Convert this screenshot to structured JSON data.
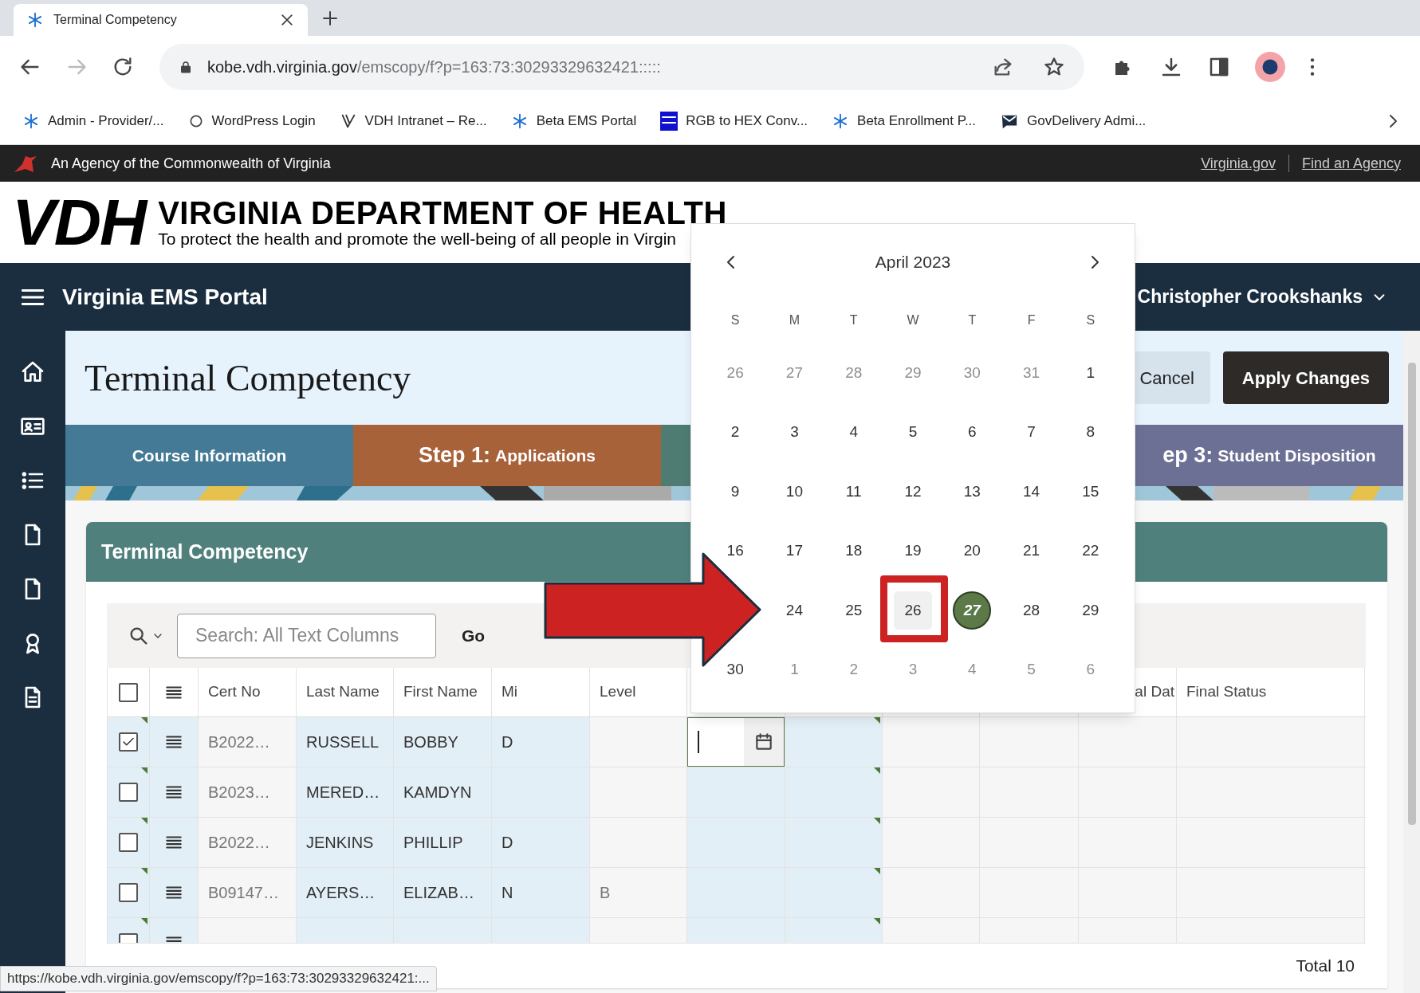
{
  "browser": {
    "tab_title": "Terminal Competency",
    "url_host": "kobe.vdh.virginia.gov",
    "url_path": "/emscopy/f?p=163:73:30293329632421:::::",
    "bookmarks": [
      {
        "label": "Admin - Provider/...",
        "kind": "asterisk"
      },
      {
        "label": "WordPress Login",
        "kind": "circle"
      },
      {
        "label": "VDH Intranet – Re...",
        "kind": "v"
      },
      {
        "label": "Beta EMS Portal",
        "kind": "asterisk"
      },
      {
        "label": "RGB to HEX Conv...",
        "kind": "square"
      },
      {
        "label": "Beta Enrollment P...",
        "kind": "asterisk"
      },
      {
        "label": "GovDelivery Admi...",
        "kind": "envelope"
      }
    ]
  },
  "agency_bar": {
    "text": "An Agency of the Commonwealth of Virginia",
    "links": [
      "Virginia.gov",
      "Find an Agency"
    ]
  },
  "header": {
    "logo": "VDH",
    "title": "VIRGINIA DEPARTMENT OF HEALTH",
    "tagline": "To protect the health and promote the well-being of all people in Virgin"
  },
  "nav": {
    "app_title": "Virginia EMS Portal",
    "user": "Christopher Crookshanks"
  },
  "page": {
    "title": "Terminal Competency",
    "buttons": [
      {
        "label": "Cancel",
        "kind": "secondary"
      },
      {
        "label": "Apply Changes",
        "kind": "primary"
      }
    ]
  },
  "steps": [
    {
      "label": "Course Information",
      "color": "#447a95"
    },
    {
      "prefix": "Step 1:",
      "label": "Applications",
      "color": "#a8623a"
    },
    {
      "color": "#4e7b72"
    },
    {
      "prefix": "ep 3:",
      "label": "Student Disposition",
      "color": "#6b7094"
    }
  ],
  "region": {
    "title": "Terminal Competency",
    "search_placeholder": "Search: All Text Columns",
    "go": "Go",
    "select_all": false,
    "columns": [
      "Cert No",
      "Last Name",
      "First Name",
      "Mi",
      "Level"
    ],
    "columns_right": [
      "al Dat",
      "Final Status"
    ],
    "rows": [
      {
        "checked": true,
        "editing": true,
        "cert_no": "B2022…",
        "last_name": "RUSSELL",
        "first_name": "BOBBY",
        "mi": "D"
      },
      {
        "checked": false,
        "editing": false,
        "cert_no": "B2023…",
        "last_name": "MERED…",
        "first_name": "KAMDYN"
      },
      {
        "checked": false,
        "editing": false,
        "cert_no": "B2022…",
        "last_name": "JENKINS",
        "first_name": "PHILLIP",
        "mi": "D"
      },
      {
        "checked": false,
        "editing": false,
        "cert_no": "B09147…",
        "last_name": "AYERS…",
        "first_name": "ELIZAB…",
        "mi": "N",
        "level": "B"
      },
      {
        "checked": false,
        "editing": false
      }
    ],
    "total": "Total 10"
  },
  "datepicker": {
    "month": "April 2023",
    "weekdays": [
      "S",
      "M",
      "T",
      "W",
      "T",
      "F",
      "S"
    ],
    "days": [
      {
        "label": "26",
        "kind": "outside",
        "selected": false
      },
      {
        "label": "27",
        "kind": "outside",
        "selected": false
      },
      {
        "label": "28",
        "kind": "outside",
        "selected": false
      },
      {
        "label": "29",
        "kind": "outside",
        "selected": false
      },
      {
        "label": "30",
        "kind": "outside",
        "selected": false
      },
      {
        "label": "31",
        "kind": "outside",
        "selected": false
      },
      {
        "label": "1",
        "kind": "inside",
        "selected": false
      },
      {
        "label": "2",
        "kind": "inside",
        "selected": false
      },
      {
        "label": "3",
        "kind": "inside",
        "selected": false
      },
      {
        "label": "4",
        "kind": "inside",
        "selected": false
      },
      {
        "label": "5",
        "kind": "inside",
        "selected": false
      },
      {
        "label": "6",
        "kind": "inside",
        "selected": false
      },
      {
        "label": "7",
        "kind": "inside",
        "selected": false
      },
      {
        "label": "8",
        "kind": "inside",
        "selected": false
      },
      {
        "label": "9",
        "kind": "inside",
        "selected": false
      },
      {
        "label": "10",
        "kind": "inside",
        "selected": false
      },
      {
        "label": "11",
        "kind": "inside",
        "selected": false
      },
      {
        "label": "12",
        "kind": "inside",
        "selected": false
      },
      {
        "label": "13",
        "kind": "inside",
        "selected": false
      },
      {
        "label": "14",
        "kind": "inside",
        "selected": false
      },
      {
        "label": "15",
        "kind": "inside",
        "selected": false
      },
      {
        "label": "16",
        "kind": "inside",
        "selected": false
      },
      {
        "label": "17",
        "kind": "inside",
        "selected": false
      },
      {
        "label": "18",
        "kind": "inside",
        "selected": false
      },
      {
        "label": "19",
        "kind": "inside",
        "selected": false
      },
      {
        "label": "20",
        "kind": "inside",
        "selected": false
      },
      {
        "label": "21",
        "kind": "inside",
        "selected": false
      },
      {
        "label": "22",
        "kind": "inside",
        "selected": false
      },
      {
        "kind": "covered"
      },
      {
        "label": "24",
        "kind": "inside",
        "selected": false
      },
      {
        "label": "25",
        "kind": "inside",
        "selected": false
      },
      {
        "label": "26",
        "kind": "inside",
        "selected": false,
        "hovered": true
      },
      {
        "label": "27",
        "kind": "inside",
        "selected": true
      },
      {
        "label": "28",
        "kind": "inside",
        "selected": false
      },
      {
        "label": "29",
        "kind": "inside",
        "selected": false
      },
      {
        "label": "30",
        "kind": "inside",
        "selected": false
      },
      {
        "label": "1",
        "kind": "outside",
        "selected": false
      },
      {
        "label": "2",
        "kind": "outside",
        "selected": false
      },
      {
        "label": "3",
        "kind": "outside",
        "selected": false
      },
      {
        "label": "4",
        "kind": "outside",
        "selected": false
      },
      {
        "label": "5",
        "kind": "outside",
        "selected": false
      },
      {
        "label": "6",
        "kind": "outside",
        "selected": false
      }
    ]
  },
  "status_url": "https://kobe.vdh.virginia.gov/emscopy/f?p=163:73:30293329632421:..."
}
